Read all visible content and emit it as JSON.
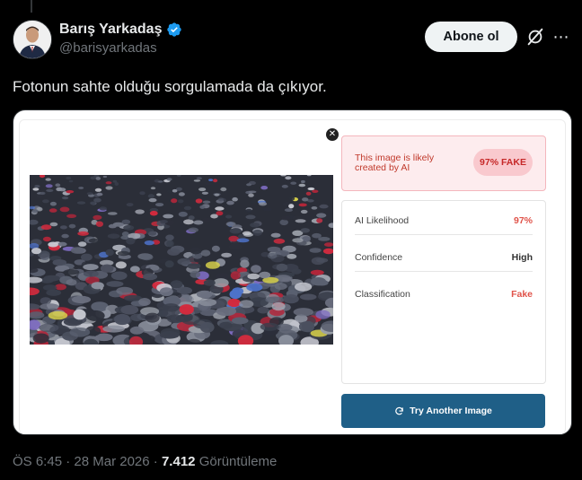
{
  "author": {
    "name": "Barış Yarkadaş",
    "handle": "@barisyarkadas",
    "verified": true,
    "verified_color": "#1d9bf0"
  },
  "actions": {
    "follow_label": "Abone ol",
    "grok_icon": "grok-icon",
    "more_icon": "more-icon"
  },
  "tweet": {
    "text": "Fotonun sahte olduğu sorgulamada da çıkıyor."
  },
  "media": {
    "close_icon": "close-icon",
    "photo": "crowd-with-umbrellas-photo",
    "result": {
      "message": "This image is likely created by AI",
      "badge": "97% FAKE"
    },
    "stats": [
      {
        "label": "AI Likelihood",
        "value": "97%"
      },
      {
        "label": "Confidence",
        "value": "High"
      },
      {
        "label": "Classification",
        "value": "Fake"
      }
    ],
    "try_button": {
      "label": "Try Another Image",
      "icon": "refresh-icon",
      "color": "#1f5f87"
    },
    "accent_red": "#c62828"
  },
  "meta": {
    "time": "ÖS 6:45",
    "date": "28 Mar 2026",
    "views_count": "7.412",
    "views_label": "Görüntüleme"
  }
}
